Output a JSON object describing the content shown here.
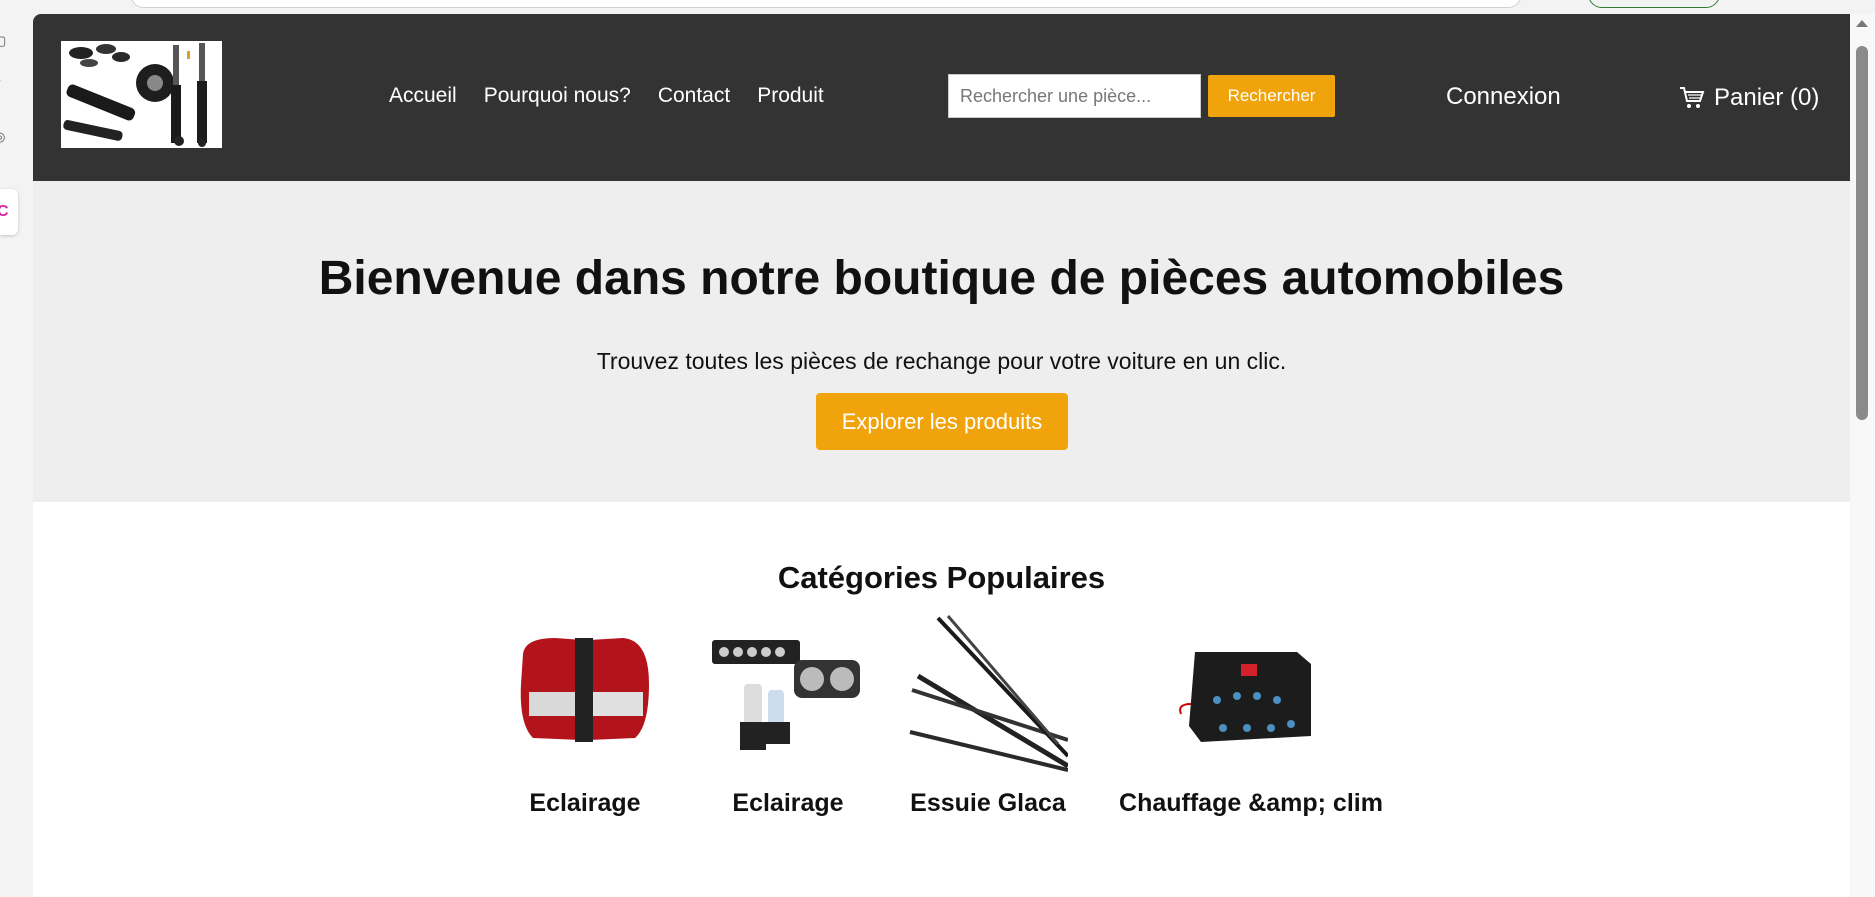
{
  "header": {
    "logo_alt": "logo",
    "nav": [
      "Accueil",
      "Pourquoi nous?",
      "Contact",
      "Produit"
    ],
    "search": {
      "placeholder": "Rechercher une pièce...",
      "button": "Rechercher"
    },
    "login": "Connexion",
    "cart": "Panier (0)",
    "cart_icon": "shopping-cart-icon"
  },
  "hero": {
    "title": "Bienvenue dans notre boutique de pièces automobiles",
    "subtitle": "Trouvez toutes les pièces de rechange pour votre voiture en un clic.",
    "cta": "Explorer les produits"
  },
  "categories": {
    "title": "Catégories Populaires",
    "items": [
      {
        "name": "Eclairage",
        "image": "tail-lights"
      },
      {
        "name": "Eclairage",
        "image": "led-bar-and-headlight"
      },
      {
        "name": "Essuie Glaca",
        "image": "wiper-blades"
      },
      {
        "name": "Chauffage &amp; clim",
        "image": "heater-box"
      }
    ]
  },
  "colors": {
    "header_bg": "#333333",
    "accent": "#f0a30a",
    "hero_bg": "#eeeeee"
  }
}
